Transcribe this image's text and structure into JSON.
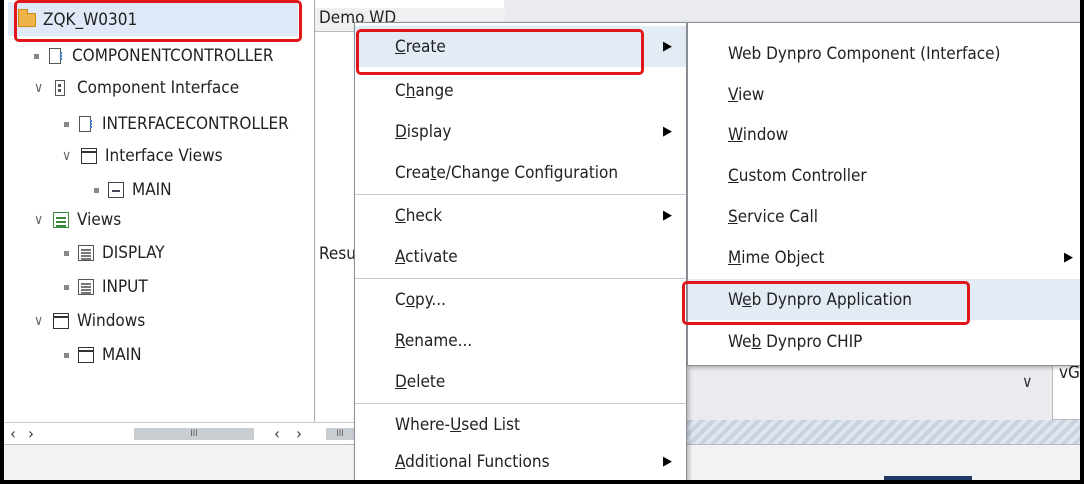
{
  "tree": {
    "root": {
      "label": "ZQK_W0301",
      "icon": "folder-icon"
    },
    "items": [
      {
        "label": "COMPONENTCONTROLLER",
        "icon": "controller-icon"
      },
      {
        "label": "Component Interface",
        "icon": "interface-icon"
      },
      {
        "label": "INTERFACECONTROLLER",
        "icon": "controller-icon"
      },
      {
        "label": "Interface Views",
        "icon": "window-icon"
      },
      {
        "label": "MAIN",
        "icon": "main-window-icon"
      },
      {
        "label": "Views",
        "icon": "views-icon"
      },
      {
        "label": "DISPLAY",
        "icon": "view-icon"
      },
      {
        "label": "INPUT",
        "icon": "view-icon"
      },
      {
        "label": "Windows",
        "icon": "window-icon"
      },
      {
        "label": "MAIN",
        "icon": "main-window-icon"
      }
    ]
  },
  "middle": {
    "header": "Demo WD",
    "result_label": "Resu"
  },
  "right": {
    "field_value": "vGu"
  },
  "context_menu": {
    "items": [
      {
        "label": "Create",
        "has_submenu": true
      },
      {
        "label": "Change",
        "has_submenu": false
      },
      {
        "label": "Display",
        "has_submenu": true
      },
      {
        "label": "Create/Change Configuration",
        "has_submenu": false
      },
      {
        "label": "Check",
        "has_submenu": true
      },
      {
        "label": "Activate",
        "has_submenu": false
      },
      {
        "label": "Copy...",
        "has_submenu": false
      },
      {
        "label": "Rename...",
        "has_submenu": false
      },
      {
        "label": "Delete",
        "has_submenu": false
      },
      {
        "label": "Where-Used List",
        "has_submenu": false
      },
      {
        "label": "Additional Functions",
        "has_submenu": true
      }
    ]
  },
  "submenu": {
    "items": [
      {
        "label": "Web Dynpro Component (Interface)",
        "has_submenu": false
      },
      {
        "label": "View",
        "has_submenu": false
      },
      {
        "label": "Window",
        "has_submenu": false
      },
      {
        "label": "Custom Controller",
        "has_submenu": false
      },
      {
        "label": "Service Call",
        "has_submenu": false
      },
      {
        "label": "Mime Object",
        "has_submenu": true
      },
      {
        "label": "Web Dynpro Application",
        "has_submenu": false
      },
      {
        "label": "Web Dynpro CHIP",
        "has_submenu": false
      }
    ]
  },
  "colors": {
    "highlight_border": "#e0161b",
    "menu_hover": "#e3ebf5",
    "folder": "#f0b34a"
  }
}
